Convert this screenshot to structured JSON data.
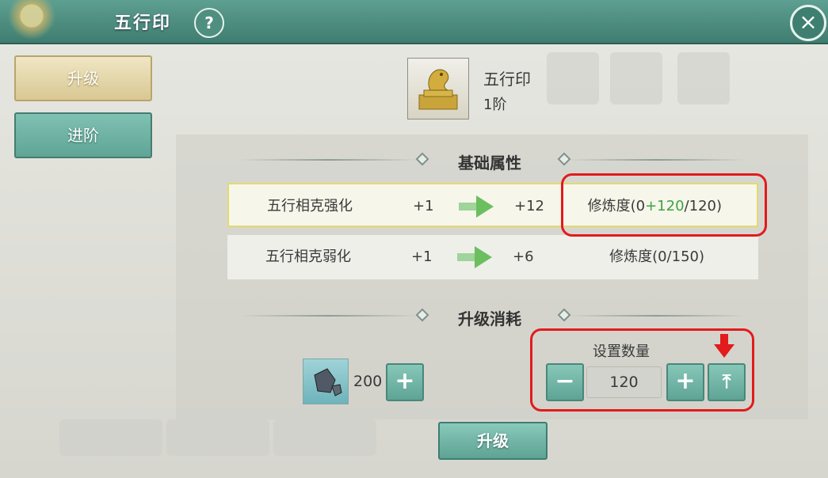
{
  "window": {
    "title": "五行印",
    "help_label": "?",
    "close_label": "×"
  },
  "tabs": [
    {
      "label": "升级",
      "active": true
    },
    {
      "label": "进阶",
      "active": false
    }
  ],
  "item": {
    "name": "五行印",
    "rank": "1阶"
  },
  "sections": {
    "base_attributes": "基础属性",
    "upgrade_cost": "升级消耗"
  },
  "attributes": [
    {
      "name": "五行相克强化",
      "from": "+1",
      "to": "+12",
      "progress_prefix": "修炼度(0",
      "progress_added": "+120",
      "progress_suffix": "/120)"
    },
    {
      "name": "五行相克弱化",
      "from": "+1",
      "to": "+6",
      "progress_text": "修炼度(0/150)"
    }
  ],
  "cost": {
    "material_count": "200",
    "add_label": "+",
    "quantity_label": "设置数量",
    "quantity_value": "120",
    "minus_label": "−",
    "plus_label": "+",
    "max_label": "⤒"
  },
  "upgrade_button": "升级",
  "colors": {
    "accent": "#5ea495",
    "highlight_border": "#e21b1b",
    "progress_green": "#3aa346"
  }
}
